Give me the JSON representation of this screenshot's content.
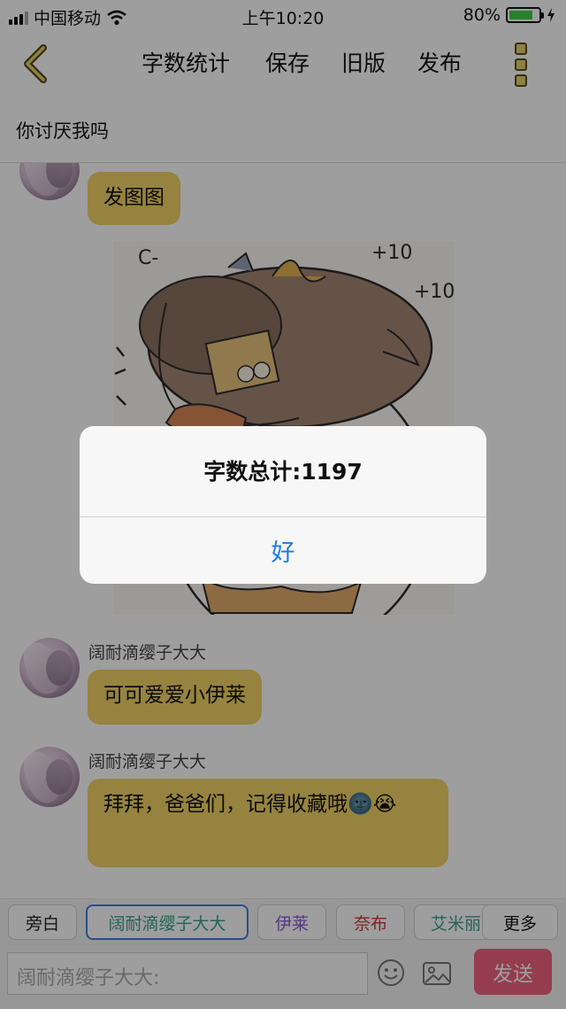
{
  "status_bar": {
    "carrier": "中国移动",
    "time": "上午10:20",
    "battery": "80%",
    "battery_level": 0.8
  },
  "nav": {
    "word_count_label": "字数统计",
    "save_label": "保存",
    "old_version_label": "旧版",
    "publish_label": "发布"
  },
  "story_title": "你讨厌我吗",
  "messages": [
    {
      "text": "发图图"
    },
    {
      "sender": "阔耐滴缨子大大",
      "text": "可可爱爱小伊莱"
    },
    {
      "sender": "阔耐滴缨子大大",
      "text": "拜拜，爸爸们，记得收藏哦🌚😭"
    }
  ],
  "image_text": {
    "mark1": "+10",
    "mark2": "+10",
    "corner": "C-"
  },
  "composer": {
    "chips": [
      {
        "label": "旁白",
        "color": "#222222"
      },
      {
        "label": "阔耐滴缨子大大",
        "color": "#3aa08a"
      },
      {
        "label": "伊莱",
        "color": "#8a5bd0"
      },
      {
        "label": "奈布",
        "color": "#d23a3a"
      },
      {
        "label": "艾米丽",
        "color": "#3aa08a"
      }
    ],
    "more_label": "更多",
    "input_placeholder": "阔耐滴缨子大大:",
    "send_label": "发送"
  },
  "alert": {
    "message": "字数总计:1197",
    "ok_label": "好"
  }
}
